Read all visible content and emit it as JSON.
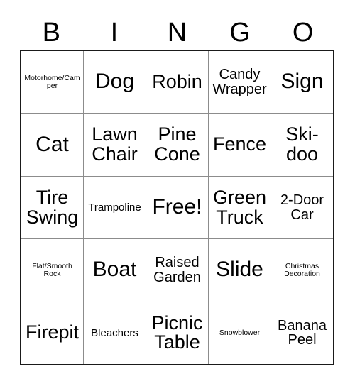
{
  "header": {
    "letters": [
      "B",
      "I",
      "N",
      "G",
      "O"
    ]
  },
  "colors": {
    "background": "#ffffff",
    "text": "#000000",
    "outer_border": "#1a1a1a",
    "inner_grid_line": "#8c8c8c"
  },
  "card": {
    "columns": 5,
    "rows": 5,
    "free_space_label": "Free!",
    "free_space_position": {
      "row": 3,
      "column": 3
    },
    "cells": [
      [
        {
          "label": "Motorhome/Camper",
          "size": "xs"
        },
        {
          "label": "Dog",
          "size": "xl"
        },
        {
          "label": "Robin",
          "size": "lg"
        },
        {
          "label": "Candy Wrapper",
          "size": "md"
        },
        {
          "label": "Sign",
          "size": "xl"
        }
      ],
      [
        {
          "label": "Cat",
          "size": "xl"
        },
        {
          "label": "Lawn Chair",
          "size": "lg"
        },
        {
          "label": "Pine Cone",
          "size": "lg"
        },
        {
          "label": "Fence",
          "size": "lg"
        },
        {
          "label": "Ski-doo",
          "size": "lg"
        }
      ],
      [
        {
          "label": "Tire Swing",
          "size": "lg"
        },
        {
          "label": "Trampoline",
          "size": "sm"
        },
        {
          "label": "Free!",
          "size": "xl"
        },
        {
          "label": "Green Truck",
          "size": "lg"
        },
        {
          "label": "2-Door Car",
          "size": "md"
        }
      ],
      [
        {
          "label": "Flat/Smooth Rock",
          "size": "xs"
        },
        {
          "label": "Boat",
          "size": "xl"
        },
        {
          "label": "Raised Garden",
          "size": "md"
        },
        {
          "label": "Slide",
          "size": "xl"
        },
        {
          "label": "Christmas Decoration",
          "size": "xs"
        }
      ],
      [
        {
          "label": "Firepit",
          "size": "lg"
        },
        {
          "label": "Bleachers",
          "size": "sm"
        },
        {
          "label": "Picnic Table",
          "size": "lg"
        },
        {
          "label": "Snowblower",
          "size": "xs"
        },
        {
          "label": "Banana Peel",
          "size": "md"
        }
      ]
    ]
  }
}
